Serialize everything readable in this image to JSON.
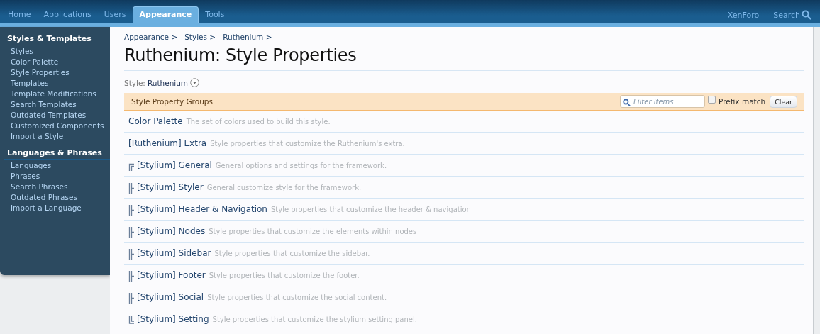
{
  "header": {
    "tabs": [
      {
        "label": "Home",
        "selected": false
      },
      {
        "label": "Applications",
        "selected": false
      },
      {
        "label": "Users",
        "selected": false
      },
      {
        "label": "Appearance",
        "selected": true
      },
      {
        "label": "Tools",
        "selected": false
      }
    ],
    "links": [
      {
        "label": "XenForo",
        "kind": "plain"
      },
      {
        "label": "Search",
        "kind": "search"
      }
    ]
  },
  "sidebar": {
    "sections": [
      {
        "heading": "Styles & Templates",
        "items": [
          "Styles",
          "Color Palette",
          "Style Properties",
          "Templates",
          "Template Modifications",
          "Search Templates",
          "Outdated Templates",
          "Customized Components",
          "Import a Style"
        ]
      },
      {
        "heading": "Languages & Phrases",
        "items": [
          "Languages",
          "Phrases",
          "Search Phrases",
          "Outdated Phrases",
          "Import a Language"
        ]
      }
    ]
  },
  "breadcrumb": [
    "Appearance >",
    "Styles >",
    "Ruthenium >"
  ],
  "title": "Ruthenium: Style Properties",
  "style_chooser": {
    "label": "Style:",
    "value": "Ruthenium"
  },
  "groups": {
    "heading": "Style Property Groups",
    "filter": {
      "placeholder": "Filter items"
    },
    "prefix_match": {
      "label": "Prefix match",
      "checked": false
    },
    "clear_button": "Clear",
    "rows": [
      {
        "title": "Color Palette",
        "description": "The set of colors used to build this style.",
        "kind": "plain"
      },
      {
        "title": "[Ruthenium] Extra",
        "description": "Style properties that customize the Ruthenium's extra.",
        "kind": "plain"
      },
      {
        "title": "[Stylium] General",
        "description": "General options and settings for the framework.",
        "kind": "first"
      },
      {
        "title": "[Stylium] Styler",
        "description": "General customize style for the framework.",
        "kind": "middle"
      },
      {
        "title": "[Stylium] Header & Navigation",
        "description": "Style properties that customize the header & navigation",
        "kind": "middle"
      },
      {
        "title": "[Stylium] Nodes",
        "description": "Style properties that customize the elements within nodes",
        "kind": "middle"
      },
      {
        "title": "[Stylium] Sidebar",
        "description": "Style properties that customize the sidebar.",
        "kind": "middle"
      },
      {
        "title": "[Stylium] Footer",
        "description": "Style properties that customize the footer.",
        "kind": "middle"
      },
      {
        "title": "[Stylium] Social",
        "description": "Style properties that customize the social content.",
        "kind": "middle"
      },
      {
        "title": "[Stylium] Setting",
        "description": "Style properties that customize the stylium setting panel.",
        "kind": "last"
      }
    ]
  }
}
